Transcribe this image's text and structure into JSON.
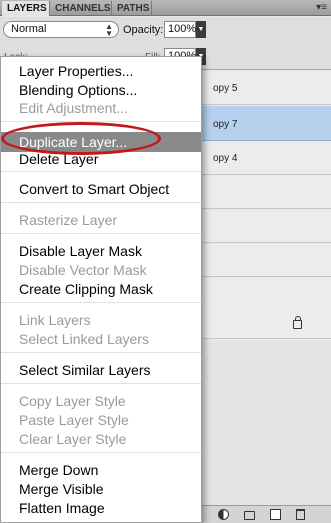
{
  "tabs": [
    {
      "label": "LAYERS"
    },
    {
      "label": "CHANNELS"
    },
    {
      "label": "PATHS"
    }
  ],
  "blend_mode": "Normal",
  "opacity": {
    "label": "Opacity:",
    "value": "100%"
  },
  "lock": {
    "label": "Lock:"
  },
  "fill": {
    "label": "Fill:",
    "value": "100%"
  },
  "layers_visible_fragments": [
    "opy 5",
    "opy 7",
    "opy 4"
  ],
  "selected_layer_color": "#b6d1ee",
  "menu_highlight_color": "#898989",
  "annotation_ring_color": "#c51818",
  "context_menu": {
    "items": [
      {
        "label": "Layer Properties...",
        "enabled": true
      },
      {
        "label": "Blending Options...",
        "enabled": true
      },
      {
        "label": "Edit Adjustment...",
        "enabled": false
      },
      {
        "label": "Duplicate Layer...",
        "enabled": true,
        "highlighted": true
      },
      {
        "label": "Delete Layer",
        "enabled": true
      },
      {
        "label": "Convert to Smart Object",
        "enabled": true
      },
      {
        "label": "Rasterize Layer",
        "enabled": false
      },
      {
        "label": "Disable Layer Mask",
        "enabled": true
      },
      {
        "label": "Disable Vector Mask",
        "enabled": false
      },
      {
        "label": "Create Clipping Mask",
        "enabled": true
      },
      {
        "label": "Link Layers",
        "enabled": false
      },
      {
        "label": "Select Linked Layers",
        "enabled": false
      },
      {
        "label": "Select Similar Layers",
        "enabled": true
      },
      {
        "label": "Copy Layer Style",
        "enabled": false
      },
      {
        "label": "Paste Layer Style",
        "enabled": false
      },
      {
        "label": "Clear Layer Style",
        "enabled": false
      },
      {
        "label": "Merge Down",
        "enabled": true
      },
      {
        "label": "Merge Visible",
        "enabled": true
      },
      {
        "label": "Flatten Image",
        "enabled": true
      }
    ]
  }
}
